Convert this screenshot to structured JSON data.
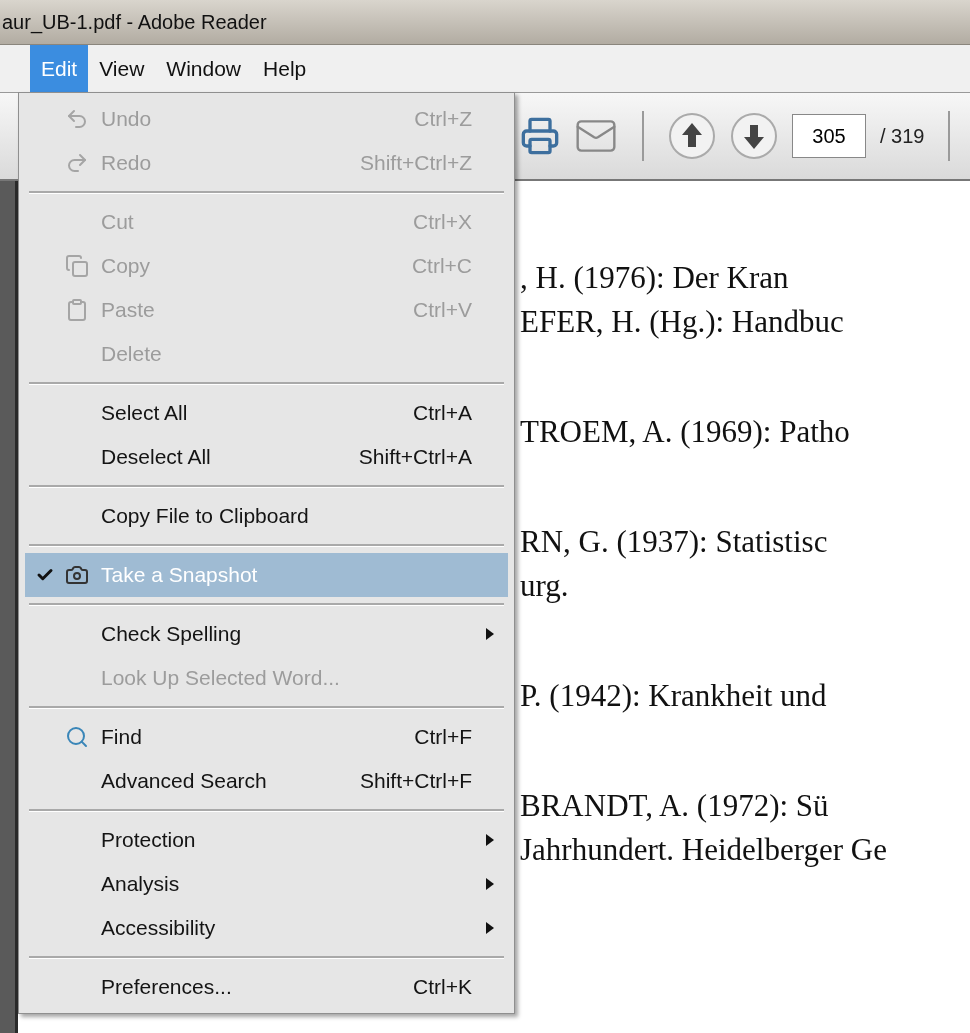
{
  "window": {
    "title": "aur_UB-1.pdf - Adobe Reader"
  },
  "menubar": [
    {
      "label": "Edit",
      "selected": true
    },
    {
      "label": "View",
      "selected": false
    },
    {
      "label": "Window",
      "selected": false
    },
    {
      "label": "Help",
      "selected": false
    }
  ],
  "toolbar": {
    "page_field": {
      "value": "305"
    },
    "page_total": "/ 319"
  },
  "edit_menu": {
    "groups": [
      [
        {
          "kind": "undo",
          "label": "Undo",
          "shortcut": "Ctrl+Z",
          "disabled": true,
          "checked": false,
          "selected": false,
          "submenu": false
        },
        {
          "kind": "redo",
          "label": "Redo",
          "shortcut": "Shift+Ctrl+Z",
          "disabled": true,
          "checked": false,
          "selected": false,
          "submenu": false
        }
      ],
      [
        {
          "kind": "plain",
          "label": "Cut",
          "shortcut": "Ctrl+X",
          "disabled": true,
          "checked": false,
          "selected": false,
          "submenu": false
        },
        {
          "kind": "copy",
          "label": "Copy",
          "shortcut": "Ctrl+C",
          "disabled": true,
          "checked": false,
          "selected": false,
          "submenu": false
        },
        {
          "kind": "paste",
          "label": "Paste",
          "shortcut": "Ctrl+V",
          "disabled": true,
          "checked": false,
          "selected": false,
          "submenu": false
        },
        {
          "kind": "plain",
          "label": "Delete",
          "disabled": true,
          "checked": false,
          "selected": false,
          "submenu": false
        }
      ],
      [
        {
          "kind": "plain",
          "label": "Select All",
          "shortcut": "Ctrl+A",
          "disabled": false,
          "checked": false,
          "selected": false,
          "submenu": false
        },
        {
          "kind": "plain",
          "label": "Deselect All",
          "shortcut": "Shift+Ctrl+A",
          "disabled": false,
          "checked": false,
          "selected": false,
          "submenu": false
        }
      ],
      [
        {
          "kind": "plain",
          "label": "Copy File to Clipboard",
          "disabled": false,
          "checked": false,
          "selected": false,
          "submenu": false
        }
      ],
      [
        {
          "kind": "snapshot",
          "label": "Take a Snapshot",
          "disabled": false,
          "checked": true,
          "selected": true,
          "submenu": false
        }
      ],
      [
        {
          "kind": "plain",
          "label": "Check Spelling",
          "disabled": false,
          "checked": false,
          "selected": false,
          "submenu": true
        },
        {
          "kind": "plain",
          "label": "Look Up Selected Word...",
          "disabled": true,
          "checked": false,
          "selected": false,
          "submenu": false
        }
      ],
      [
        {
          "kind": "find",
          "label": "Find",
          "shortcut": "Ctrl+F",
          "disabled": false,
          "checked": false,
          "selected": false,
          "submenu": false
        },
        {
          "kind": "plain",
          "label": "Advanced Search",
          "shortcut": "Shift+Ctrl+F",
          "disabled": false,
          "checked": false,
          "selected": false,
          "submenu": false
        }
      ],
      [
        {
          "kind": "plain",
          "label": "Protection",
          "disabled": false,
          "checked": false,
          "selected": false,
          "submenu": true
        },
        {
          "kind": "plain",
          "label": "Analysis",
          "disabled": false,
          "checked": false,
          "selected": false,
          "submenu": true
        },
        {
          "kind": "plain",
          "label": "Accessibility",
          "disabled": false,
          "checked": false,
          "selected": false,
          "submenu": true
        }
      ],
      [
        {
          "kind": "plain",
          "label": "Preferences...",
          "shortcut": "Ctrl+K",
          "disabled": false,
          "checked": false,
          "selected": false,
          "submenu": false
        }
      ]
    ]
  },
  "document": {
    "entries": [
      [
        ", H. (1976): Der Kran",
        "EFER, H. (Hg.): Handbuc"
      ],
      [
        "TROEM, A. (1969): Patho"
      ],
      [
        "RN, G. (1937): Statistisc",
        "urg."
      ],
      [
        "P. (1942): Krankheit und"
      ],
      [
        "BRANDT, A. (1972): Sü",
        "Jahrhundert. Heidelberger Ge"
      ]
    ]
  }
}
